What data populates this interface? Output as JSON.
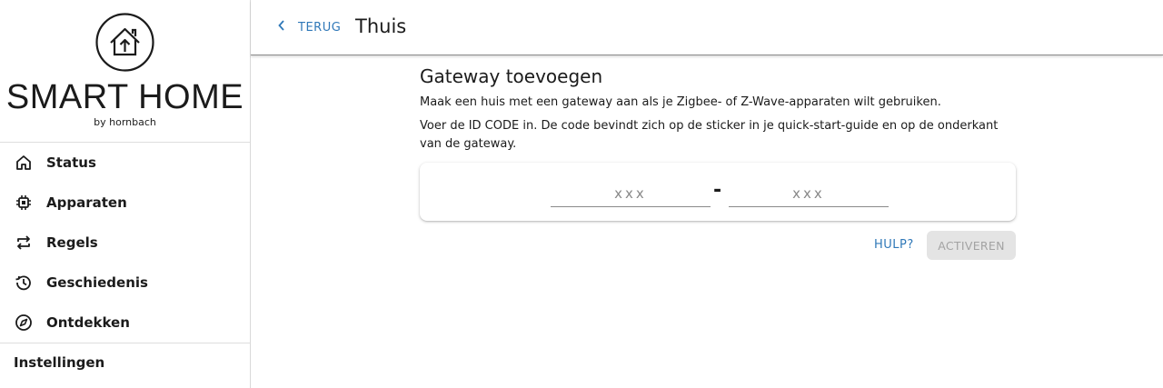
{
  "brand": {
    "title": "SMART HOME",
    "subtitle": "by hornbach"
  },
  "sidebar": {
    "items": [
      {
        "label": "Status",
        "icon": "home-icon"
      },
      {
        "label": "Apparaten",
        "icon": "chip-icon"
      },
      {
        "label": "Regels",
        "icon": "repeat-icon"
      },
      {
        "label": "Geschiedenis",
        "icon": "history-icon"
      },
      {
        "label": "Ontdekken",
        "icon": "compass-icon"
      }
    ],
    "settings_label": "Instellingen"
  },
  "header": {
    "back_label": "TERUG",
    "title": "Thuis"
  },
  "main": {
    "heading": "Gateway toevoegen",
    "intro": "Maak een huis met een gateway aan als je Zigbee- of Z-Wave-apparaten wilt gebruiken.",
    "instructions": "Voer de ID CODE in. De code bevindt zich op de sticker in je quick-start-guide en op de onderkant van de gateway.",
    "code": {
      "part1_placeholder": "xxx",
      "part1_value": "",
      "separator": "-",
      "part2_placeholder": "xxx",
      "part2_value": ""
    },
    "help_label": "HULP?",
    "activate_label": "ACTIVEREN"
  },
  "colors": {
    "accent": "#2f78b8",
    "disabled_bg": "#e4e4e4",
    "disabled_text": "#a3a3a3"
  }
}
